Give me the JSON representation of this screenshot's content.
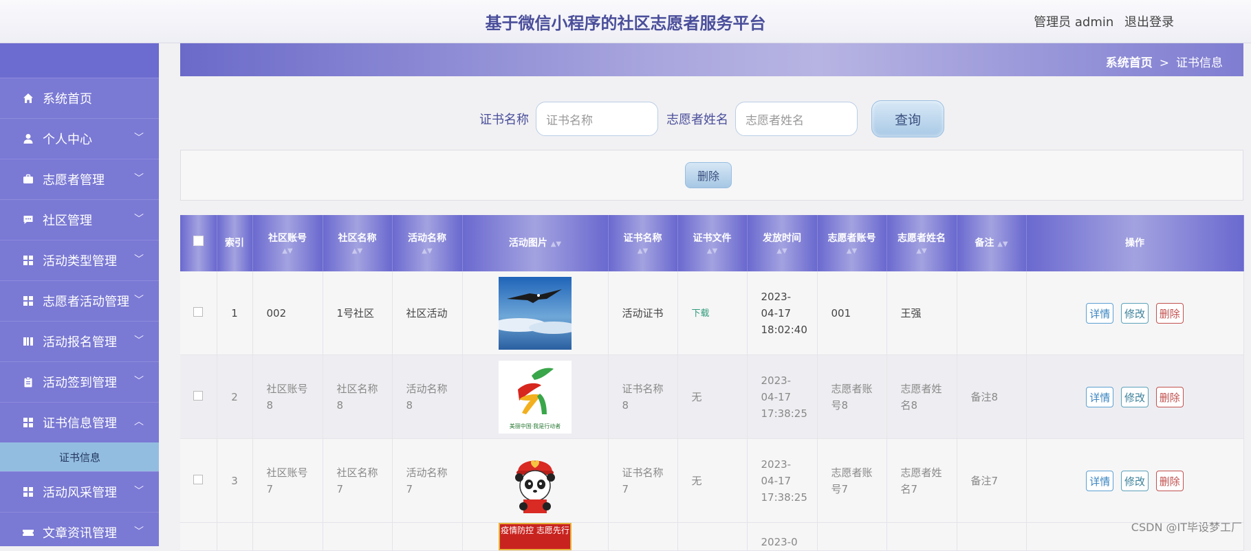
{
  "header": {
    "title": "基于微信小程序的社区志愿者服务平台",
    "user": "管理员 admin",
    "logout": "退出登录"
  },
  "sidebar": {
    "items": [
      {
        "label": "系统首页",
        "icon": "home-icon"
      },
      {
        "label": "个人中心",
        "icon": "user-icon"
      },
      {
        "label": "志愿者管理",
        "icon": "briefcase-icon"
      },
      {
        "label": "社区管理",
        "icon": "chat-icon"
      },
      {
        "label": "活动类型管理",
        "icon": "grid-icon"
      },
      {
        "label": "志愿者活动管理",
        "icon": "grid-icon"
      },
      {
        "label": "活动报名管理",
        "icon": "book-icon"
      },
      {
        "label": "活动签到管理",
        "icon": "clipboard-icon"
      },
      {
        "label": "证书信息管理",
        "icon": "grid-icon"
      },
      {
        "label": "活动风采管理",
        "icon": "grid-icon"
      },
      {
        "label": "文章资讯管理",
        "icon": "ticket-icon"
      }
    ],
    "sub_item": "证书信息"
  },
  "breadcrumb": {
    "home": "系统首页",
    "sep": ">",
    "current": "证书信息"
  },
  "search": {
    "cert_label": "证书名称",
    "cert_placeholder": "证书名称",
    "name_label": "志愿者姓名",
    "name_placeholder": "志愿者姓名",
    "button": "查询"
  },
  "toolbar": {
    "delete": "删除"
  },
  "table": {
    "headers": [
      "索引",
      "社区账号",
      "社区名称",
      "活动名称",
      "活动图片",
      "证书名称",
      "证书文件",
      "发放时间",
      "志愿者账号",
      "志愿者姓名",
      "备注",
      "操作"
    ],
    "rows": [
      {
        "index": "1",
        "community_account": "002",
        "community_name": "1号社区",
        "activity_name": "社区活动",
        "cert_name": "活动证书",
        "cert_file": "下载",
        "time": "2023-04-17 18:02:40",
        "vol_account": "001",
        "vol_name": "王强",
        "remark": "",
        "image": "eagle-image"
      },
      {
        "index": "2",
        "community_account": "社区账号8",
        "community_name": "社区名称8",
        "activity_name": "活动名称8",
        "cert_name": "证书名称8",
        "cert_file": "无",
        "time": "2023-04-17 17:38:25",
        "vol_account": "志愿者账号8",
        "vol_name": "志愿者姓名8",
        "remark": "备注8",
        "image": "volunteer-logo-image"
      },
      {
        "index": "3",
        "community_account": "社区账号7",
        "community_name": "社区名称7",
        "activity_name": "活动名称7",
        "cert_name": "证书名称7",
        "cert_file": "无",
        "time": "2023-04-17 17:38:25",
        "vol_account": "志愿者账号7",
        "vol_name": "志愿者姓名7",
        "remark": "备注7",
        "image": "panda-mascot-image"
      },
      {
        "index": "",
        "community_account": "",
        "community_name": "",
        "activity_name": "",
        "cert_name": "",
        "cert_file": "",
        "time": "2023-0",
        "vol_account": "",
        "vol_name": "",
        "remark": "",
        "image": "poster-image"
      }
    ],
    "actions": {
      "detail": "详情",
      "edit": "修改",
      "delete": "删除"
    },
    "poster_text": "疫情防控 志愿先行",
    "logo_caption": "美丽中国·我是行动者"
  },
  "watermark": "CSDN @IT毕设梦工厂"
}
